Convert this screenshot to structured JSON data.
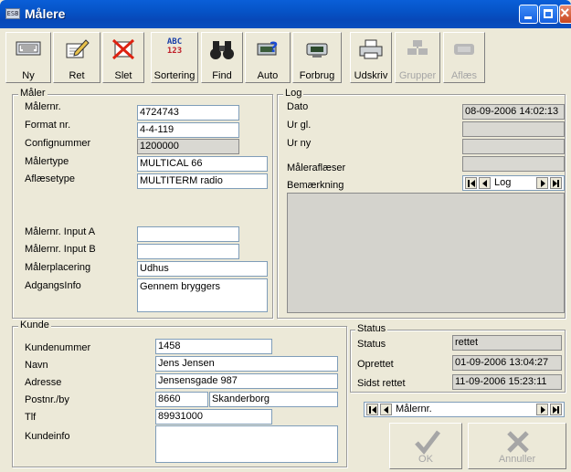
{
  "window": {
    "title": "Målere",
    "app_icon_text": "ESB"
  },
  "toolbar": {
    "buttons": [
      {
        "id": "ny",
        "label": "Ny",
        "icon": "keyboard-icon",
        "enabled": true
      },
      {
        "id": "ret",
        "label": "Ret",
        "icon": "edit-pencil-icon",
        "enabled": true
      },
      {
        "id": "slet",
        "label": "Slet",
        "icon": "delete-x-icon",
        "enabled": true
      },
      {
        "id": "sortering",
        "label": "Sortering",
        "icon": "abc-123-icon",
        "enabled": true
      },
      {
        "id": "find",
        "label": "Find",
        "icon": "binoculars-icon",
        "enabled": true
      },
      {
        "id": "auto",
        "label": "Auto",
        "icon": "auto-help-icon",
        "enabled": true
      },
      {
        "id": "forbrug",
        "label": "Forbrug",
        "icon": "meter-icon",
        "enabled": true
      },
      {
        "id": "udskriv",
        "label": "Udskriv",
        "icon": "printer-icon",
        "enabled": true
      },
      {
        "id": "grupper",
        "label": "Grupper",
        "icon": "groups-icon",
        "enabled": false
      },
      {
        "id": "aflaes",
        "label": "Aflæs",
        "icon": "read-meter-icon",
        "enabled": false
      }
    ],
    "abc_text": "ABC",
    "num_text": "123"
  },
  "maler": {
    "title": "Måler",
    "fields": {
      "malernr": {
        "label": "Målernr.",
        "value": "4724743"
      },
      "format": {
        "label": "Format nr.",
        "value": "4-4-119"
      },
      "config": {
        "label": "Confignummer",
        "value": "1200000"
      },
      "malertype": {
        "label": "Målertype",
        "value": "MULTICAL 66"
      },
      "aflaesetype": {
        "label": "Aflæsetype",
        "value": "MULTITERM radio"
      },
      "inputa": {
        "label": "Målernr. Input A",
        "value": ""
      },
      "inputb": {
        "label": "Målernr. Input B",
        "value": ""
      },
      "placering": {
        "label": "Målerplacering",
        "value": "Udhus"
      },
      "adgang": {
        "label": "AdgangsInfo",
        "value": "Gennem bryggers"
      }
    }
  },
  "log": {
    "title": "Log",
    "dato": {
      "label": "Dato",
      "value": "08-09-2006 14:02:13"
    },
    "ur_gl": {
      "label": "Ur gl.",
      "value": ""
    },
    "ur_ny": {
      "label": "Ur ny",
      "value": ""
    },
    "maleraflaeser": {
      "label": "Måleraflæser",
      "value": ""
    },
    "bemaerkning": {
      "label": "Bemærkning",
      "value": ""
    },
    "nav_label": "Log"
  },
  "kunde": {
    "title": "Kunde",
    "kundenummer": {
      "label": "Kundenummer",
      "value": "1458"
    },
    "navn": {
      "label": "Navn",
      "value": "Jens Jensen"
    },
    "adresse": {
      "label": "Adresse",
      "value": "Jensensgade 987"
    },
    "postnr": {
      "label": "Postnr./by",
      "value": "8660",
      "by": "Skanderborg"
    },
    "tlf": {
      "label": "Tlf",
      "value": "89931000"
    },
    "kundeinfo": {
      "label": "Kundeinfo",
      "value": ""
    }
  },
  "status": {
    "title": "Status",
    "status": {
      "label": "Status",
      "value": "rettet"
    },
    "oprettet": {
      "label": "Oprettet",
      "value": "01-09-2006 13:04:27"
    },
    "sidst_rettet": {
      "label": "Sidst rettet",
      "value": "11-09-2006 15:23:11"
    },
    "nav_label": "Målernr."
  },
  "actions": {
    "ok": "OK",
    "annuller": "Annuller"
  }
}
